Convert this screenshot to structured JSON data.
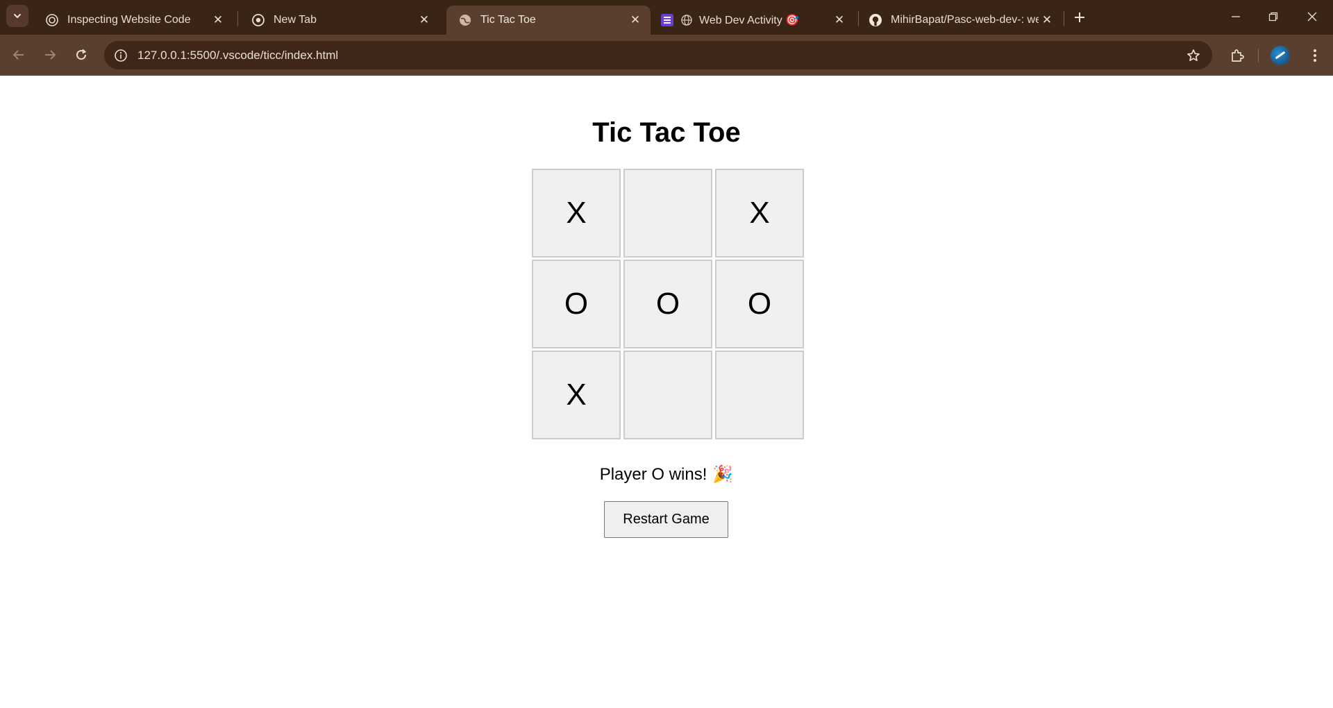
{
  "browser": {
    "tabs": [
      {
        "title": "Inspecting Website Code",
        "icon": "chatgpt-icon",
        "active": false
      },
      {
        "title": "New Tab",
        "icon": "chrome-icon",
        "active": false
      },
      {
        "title": "Tic Tac Toe",
        "icon": "globe-icon",
        "active": true
      },
      {
        "title": "Web Dev Activity 🎯",
        "icon": "forms-icon",
        "active": false
      },
      {
        "title": "MihirBapat/Pasc-web-dev-: web",
        "icon": "github-icon",
        "active": false
      }
    ],
    "url": "127.0.0.1:5500/.vscode/ticc/index.html",
    "colors": {
      "frame": "#3a2416",
      "toolbar": "#5a3f2f",
      "omnibox": "#3e2719"
    }
  },
  "page": {
    "title": "Tic Tac Toe",
    "board": [
      "X",
      "",
      "X",
      "O",
      "O",
      "O",
      "X",
      "",
      ""
    ],
    "status": "Player O wins!",
    "status_emoji": "🎉",
    "restart_label": "Restart Game"
  }
}
